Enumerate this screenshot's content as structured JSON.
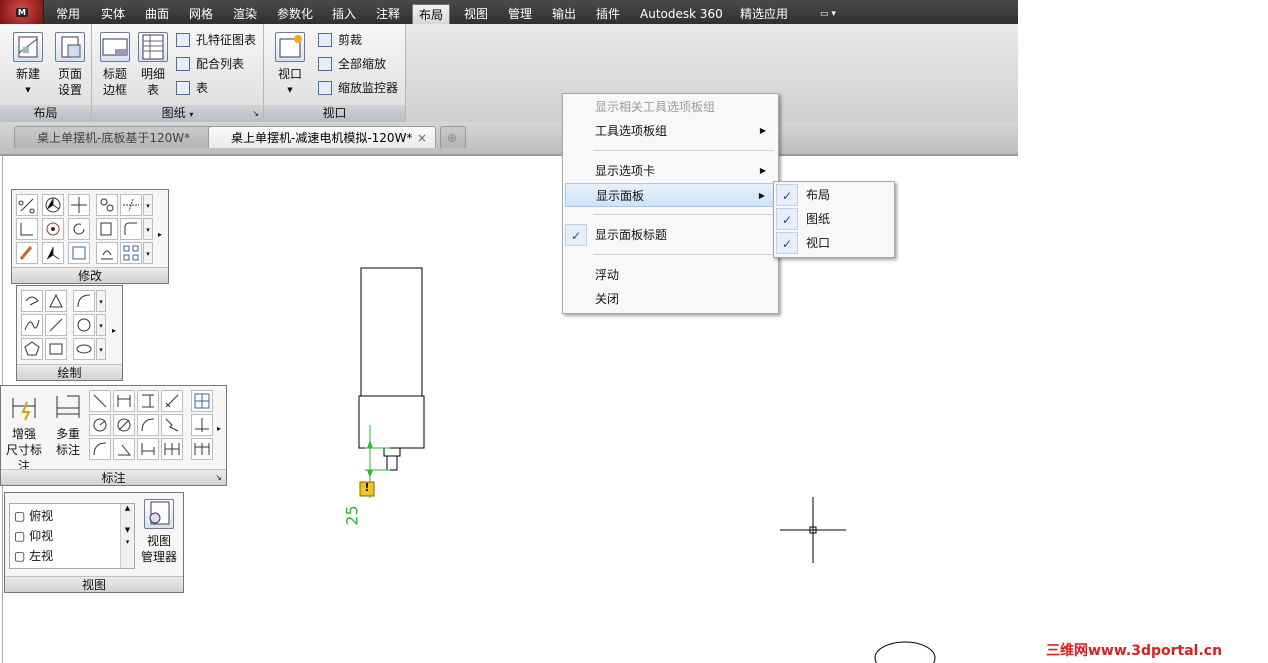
{
  "app": {
    "button_label": "M"
  },
  "menu": {
    "tabs": [
      "常用",
      "实体",
      "曲面",
      "网格",
      "渲染",
      "参数化",
      "插入",
      "注释",
      "布局",
      "视图",
      "管理",
      "输出",
      "插件",
      "Autodesk 360",
      "精选应用"
    ],
    "active": "布局"
  },
  "ribbon": {
    "layout_panel": {
      "title": "布局",
      "new_label": "新建",
      "page_setup_line1": "页面",
      "page_setup_line2": "设置"
    },
    "drawing_panel": {
      "title": "图纸",
      "title_block_line1": "标题",
      "title_block_line2": "边框",
      "bom_line1": "明细",
      "bom_line2": "表",
      "hole_chart": "孔特征图表",
      "fit_list": "配合列表",
      "table": "表"
    },
    "viewport_panel": {
      "title": "视口",
      "viewport": "视口",
      "clip": "剪裁",
      "zoom_all": "全部缩放",
      "zoom_monitor": "缩放监控器"
    }
  },
  "doc_tabs": [
    {
      "label": "桌上单摆机-底板基于120W*",
      "active": false
    },
    {
      "label": "桌上单摆机-减速电机模拟-120W*",
      "active": true
    }
  ],
  "float_panels": {
    "modify": {
      "title": "修改"
    },
    "draw": {
      "title": "绘制"
    },
    "dimension": {
      "title": "标注",
      "enhanced_line1": "增强",
      "enhanced_line2": "尺寸标注",
      "multi_line1": "多重",
      "multi_line2": "标注"
    },
    "view": {
      "title": "视图",
      "list": [
        "俯视",
        "仰视",
        "左视"
      ],
      "manager_line1": "视图",
      "manager_line2": "管理器"
    }
  },
  "context_menu": {
    "items": [
      {
        "label": "显示相关工具选项板组",
        "disabled": true
      },
      {
        "label": "工具选项板组",
        "submenu": true
      },
      {
        "label": "显示选项卡",
        "submenu": true
      },
      {
        "label": "显示面板",
        "submenu": true,
        "highlighted": true
      },
      {
        "label": "显示面板标题",
        "checked": true
      },
      {
        "label": "浮动"
      },
      {
        "label": "关闭"
      }
    ],
    "submenu": [
      {
        "label": "布局",
        "checked": true
      },
      {
        "label": "图纸",
        "checked": true
      },
      {
        "label": "视口",
        "checked": true
      }
    ]
  },
  "drawing": {
    "dimension_value": "25",
    "warning_symbol": "!"
  },
  "watermark": "三维网www.3dportal.cn",
  "colors": {
    "accent": "#1a4fa0",
    "dimension": "#2db82d",
    "warning": "#f0c419",
    "watermark": "#d92020"
  }
}
